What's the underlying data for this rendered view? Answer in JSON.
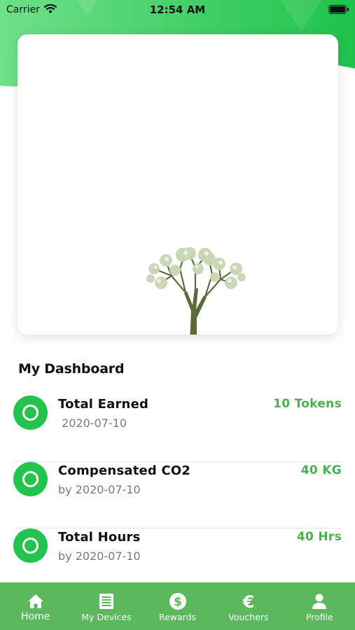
{
  "status_bar": {
    "carrier": "Carrier",
    "time": "12:54 AM"
  },
  "colors": {
    "accent_green": "#22c44d",
    "value_green": "#4caf50",
    "tab_bar_green": "#5cb85c",
    "header_gradient": [
      "#6fe08a",
      "#1ec24a"
    ]
  },
  "dashboard": {
    "title": "My Dashboard",
    "stats": [
      {
        "icon": "ring-icon",
        "label": "Total Earned",
        "sub": " 2020-07-10",
        "value": "10 Tokens"
      },
      {
        "icon": "ring-icon",
        "label": "Compensated CO2",
        "sub": "by 2020-07-10",
        "value": "40 KG"
      },
      {
        "icon": "ring-icon",
        "label": "Total Hours",
        "sub": "by 2020-07-10",
        "value": "40 Hrs"
      }
    ]
  },
  "tab_bar": {
    "tabs": [
      {
        "label": "Home",
        "icon": "home-icon",
        "active": true
      },
      {
        "label": "My Devices",
        "icon": "devices-icon",
        "active": false
      },
      {
        "label": "Rewards",
        "icon": "dollar-icon",
        "active": false
      },
      {
        "label": "Vouchers",
        "icon": "euro-icon",
        "active": false
      },
      {
        "label": "Profile",
        "icon": "person-icon",
        "active": false
      }
    ]
  }
}
